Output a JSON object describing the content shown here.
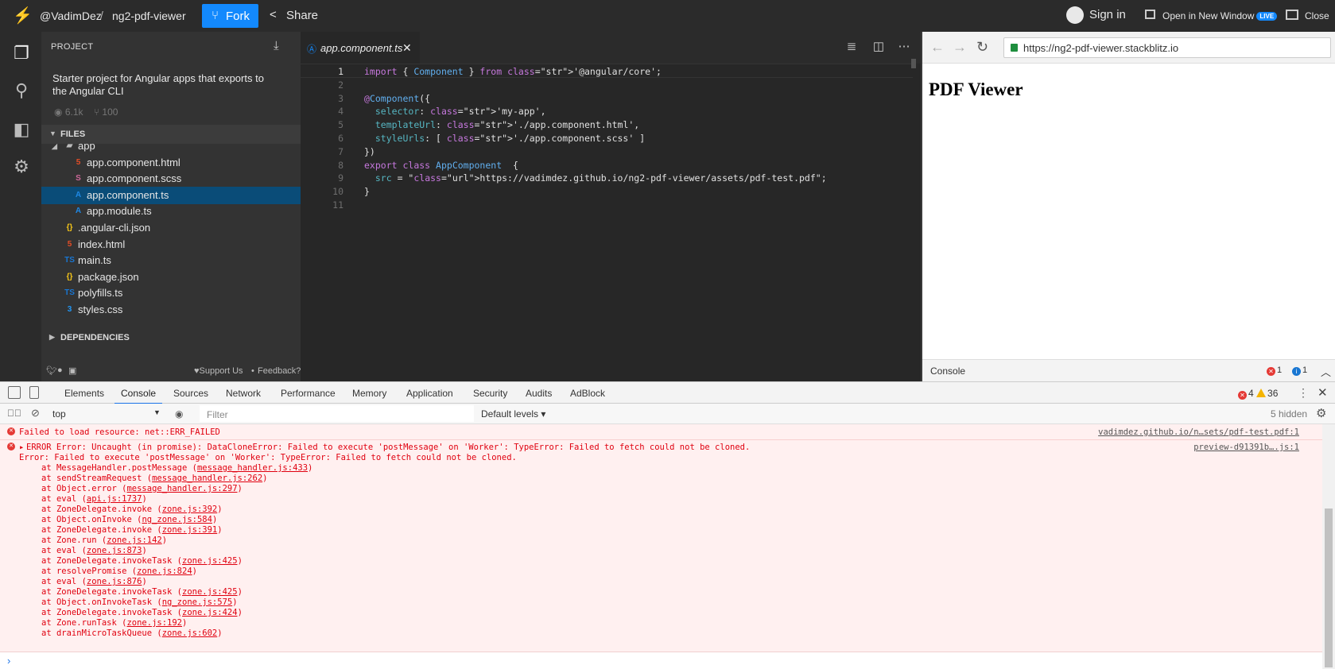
{
  "topbar": {
    "owner": "@VadimDez",
    "separator": "/",
    "project": "ng2-pdf-viewer",
    "fork_label": "Fork",
    "share_label": "Share",
    "signin_label": "Sign in",
    "open_window_label": "Open in New Window",
    "live_badge": "LIVE",
    "close_label": "Close"
  },
  "activity": [
    "files-icon",
    "search-icon",
    "extensions-icon",
    "settings-icon"
  ],
  "sidebar": {
    "title": "PROJECT",
    "description": "Starter project for Angular apps that exports to the Angular CLI",
    "views": "6.1k",
    "forks": "100",
    "files_header": "FILES",
    "dependencies_header": "DEPENDENCIES",
    "tree": [
      {
        "name": "app",
        "type": "folder"
      },
      {
        "name": "app.component.html",
        "type": "html"
      },
      {
        "name": "app.component.scss",
        "type": "scss"
      },
      {
        "name": "app.component.ts",
        "type": "angular",
        "selected": true
      },
      {
        "name": "app.module.ts",
        "type": "angular"
      },
      {
        "name": ".angular-cli.json",
        "type": "json"
      },
      {
        "name": "index.html",
        "type": "html"
      },
      {
        "name": "main.ts",
        "type": "ts"
      },
      {
        "name": "package.json",
        "type": "json"
      },
      {
        "name": "polyfills.ts",
        "type": "ts"
      },
      {
        "name": "styles.css",
        "type": "css"
      }
    ],
    "footer_support": "Support Us",
    "footer_feedback": "Feedback?"
  },
  "editor": {
    "tab_label": "app.component.ts",
    "line_numbers": [
      "1",
      "2",
      "3",
      "4",
      "5",
      "6",
      "7",
      "8",
      "9",
      "10",
      "11"
    ],
    "lines": [
      "import { Component } from '@angular/core';",
      "",
      "@Component({",
      "  selector: 'my-app',",
      "  templateUrl: './app.component.html',",
      "  styleUrls: [ './app.component.scss' ]",
      "})",
      "export class AppComponent  {",
      "  src = \"https://vadimdez.github.io/ng2-pdf-viewer/assets/pdf-test.pdf\";",
      "}",
      ""
    ]
  },
  "preview": {
    "url": "https://ng2-pdf-viewer.stackblitz.io",
    "page_title": "PDF Viewer",
    "console_label": "Console",
    "error_count": "1",
    "info_count": "1"
  },
  "devtools": {
    "tabs": [
      "Elements",
      "Console",
      "Sources",
      "Network",
      "Performance",
      "Memory",
      "Application",
      "Security",
      "Audits",
      "AdBlock"
    ],
    "active_tab": "Console",
    "error_count": "4",
    "warning_count": "36",
    "context": "top",
    "filter_placeholder": "Filter",
    "levels": "Default levels",
    "hidden": "5 hidden",
    "messages": [
      {
        "text": "Failed to load resource: net::ERR_FAILED",
        "source": "vadimdez.github.io/n…sets/pdf-test.pdf:1"
      },
      {
        "text": "ERROR Error: Uncaught (in promise): DataCloneError: Failed to execute 'postMessage' on 'Worker': TypeError: Failed to fetch could not be cloned.",
        "source": "preview-d91391b….js:1"
      }
    ],
    "error_detail": "Error: Failed to execute 'postMessage' on 'Worker': TypeError: Failed to fetch could not be cloned.",
    "stack": [
      {
        "fn": "at MessageHandler.postMessage (",
        "loc": "message_handler.js:433"
      },
      {
        "fn": "at sendStreamRequest (",
        "loc": "message_handler.js:262"
      },
      {
        "fn": "at Object.error (",
        "loc": "message_handler.js:297"
      },
      {
        "fn": "at eval (",
        "loc": "api.js:1737"
      },
      {
        "fn": "at ZoneDelegate.invoke (",
        "loc": "zone.js:392"
      },
      {
        "fn": "at Object.onInvoke (",
        "loc": "ng_zone.js:584"
      },
      {
        "fn": "at ZoneDelegate.invoke (",
        "loc": "zone.js:391"
      },
      {
        "fn": "at Zone.run (",
        "loc": "zone.js:142"
      },
      {
        "fn": "at eval (",
        "loc": "zone.js:873"
      },
      {
        "fn": "at ZoneDelegate.invokeTask (",
        "loc": "zone.js:425"
      },
      {
        "fn": "at resolvePromise (",
        "loc": "zone.js:824"
      },
      {
        "fn": "at eval (",
        "loc": "zone.js:876"
      },
      {
        "fn": "at ZoneDelegate.invokeTask (",
        "loc": "zone.js:425"
      },
      {
        "fn": "at Object.onInvokeTask (",
        "loc": "ng_zone.js:575"
      },
      {
        "fn": "at ZoneDelegate.invokeTask (",
        "loc": "zone.js:424"
      },
      {
        "fn": "at Zone.runTask (",
        "loc": "zone.js:192"
      },
      {
        "fn": "at drainMicroTaskQueue (",
        "loc": "zone.js:602"
      }
    ]
  }
}
